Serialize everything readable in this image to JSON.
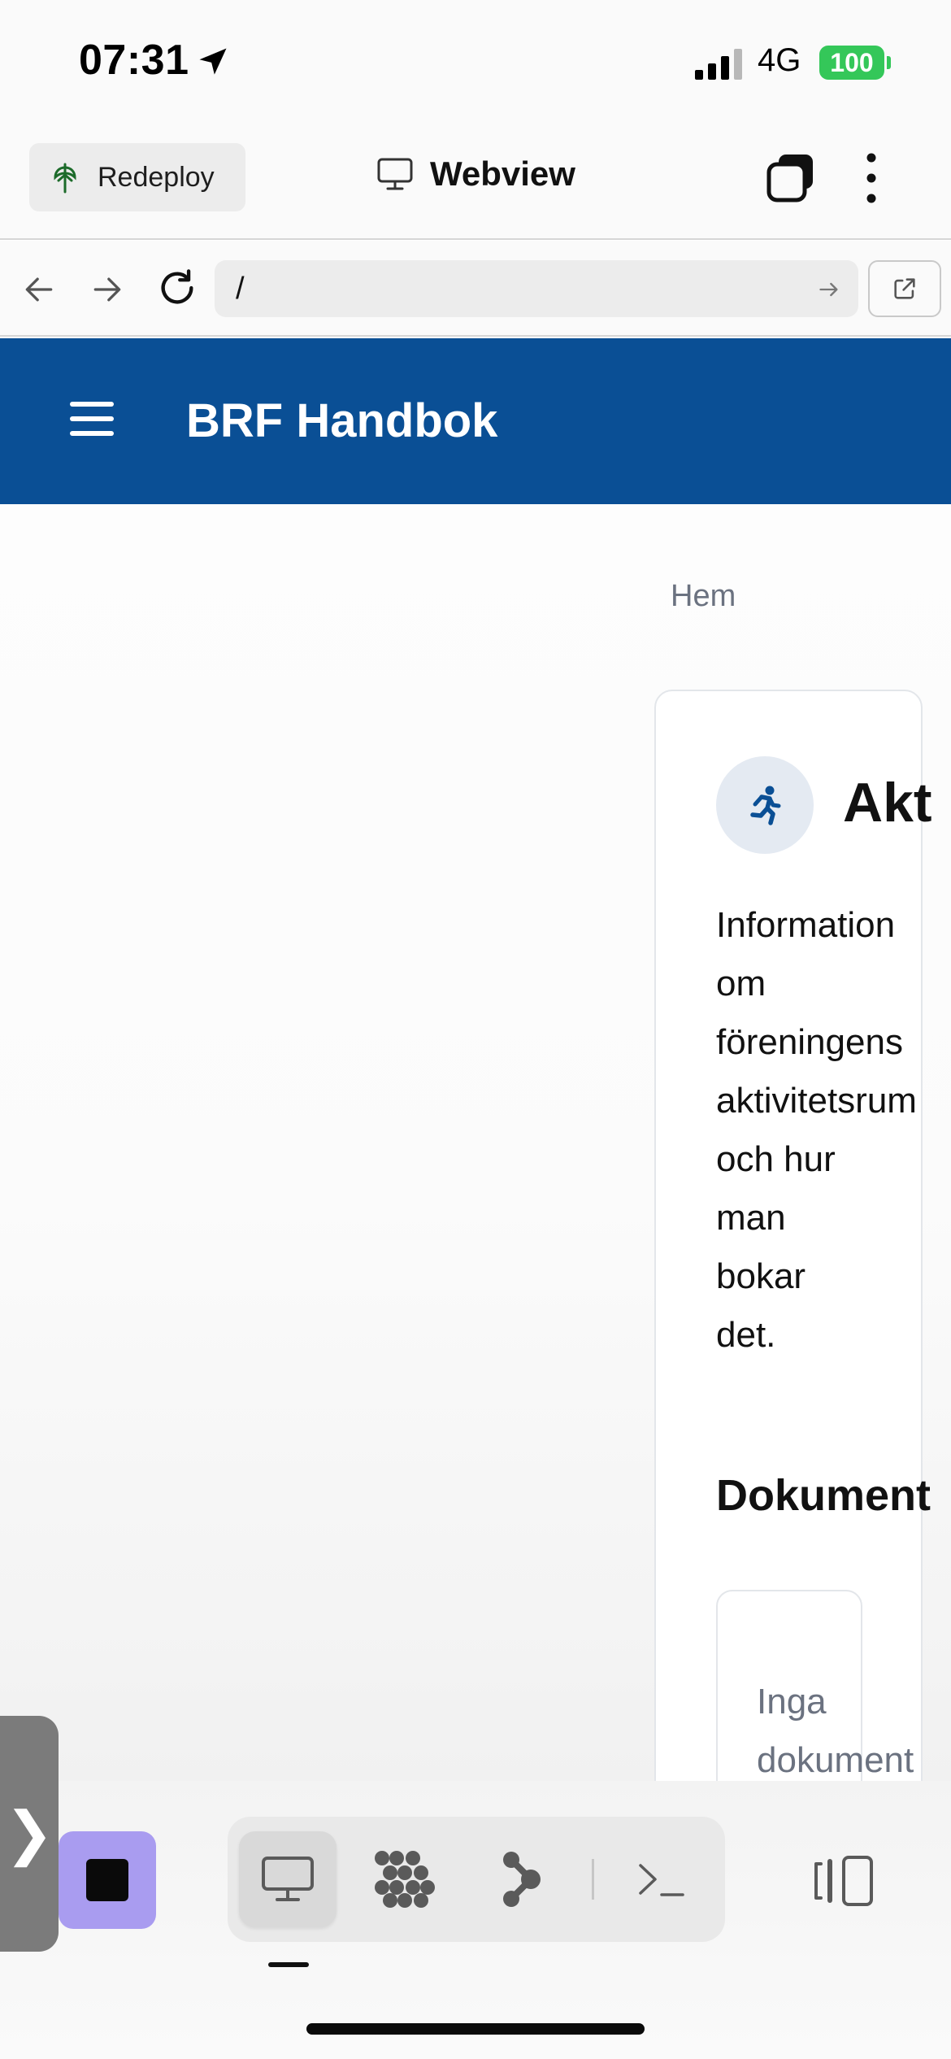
{
  "status_bar": {
    "time": "07:31",
    "network": "4G",
    "battery": "100",
    "battery_color": "#34c759",
    "icons": [
      "location-arrow-icon",
      "signal-bars-icon"
    ]
  },
  "app_toolbar": {
    "redeploy_label": "Redeploy",
    "title": "Webview",
    "icons": [
      "tree-icon",
      "monitor-icon",
      "tabs-icon",
      "more-vertical-icon"
    ]
  },
  "url_bar": {
    "url": "/",
    "icons": [
      "back-arrow-icon",
      "forward-arrow-icon",
      "reload-icon",
      "go-arrow-icon",
      "external-link-icon"
    ]
  },
  "site": {
    "title": "BRF Handbok",
    "header_color": "#0a4f95",
    "breadcrumb": "Hem",
    "card": {
      "title": "Akt",
      "icon": "running-person-icon",
      "description_lines": [
        "Information",
        "om",
        "föreningens",
        "aktivitetsrum",
        "och hur",
        "man",
        "bokar",
        "det."
      ],
      "section_title": "Dokument",
      "empty_lines": [
        "Inga",
        "dokument"
      ]
    }
  },
  "dock": {
    "side_handle_glyph": "❯",
    "stop_color": "#a99cf0",
    "items": [
      "monitor-icon",
      "apps-grid-icon",
      "graph-nodes-icon",
      "terminal-icon"
    ],
    "active_item": "monitor-icon",
    "panel_icon": "split-panel-icon"
  }
}
